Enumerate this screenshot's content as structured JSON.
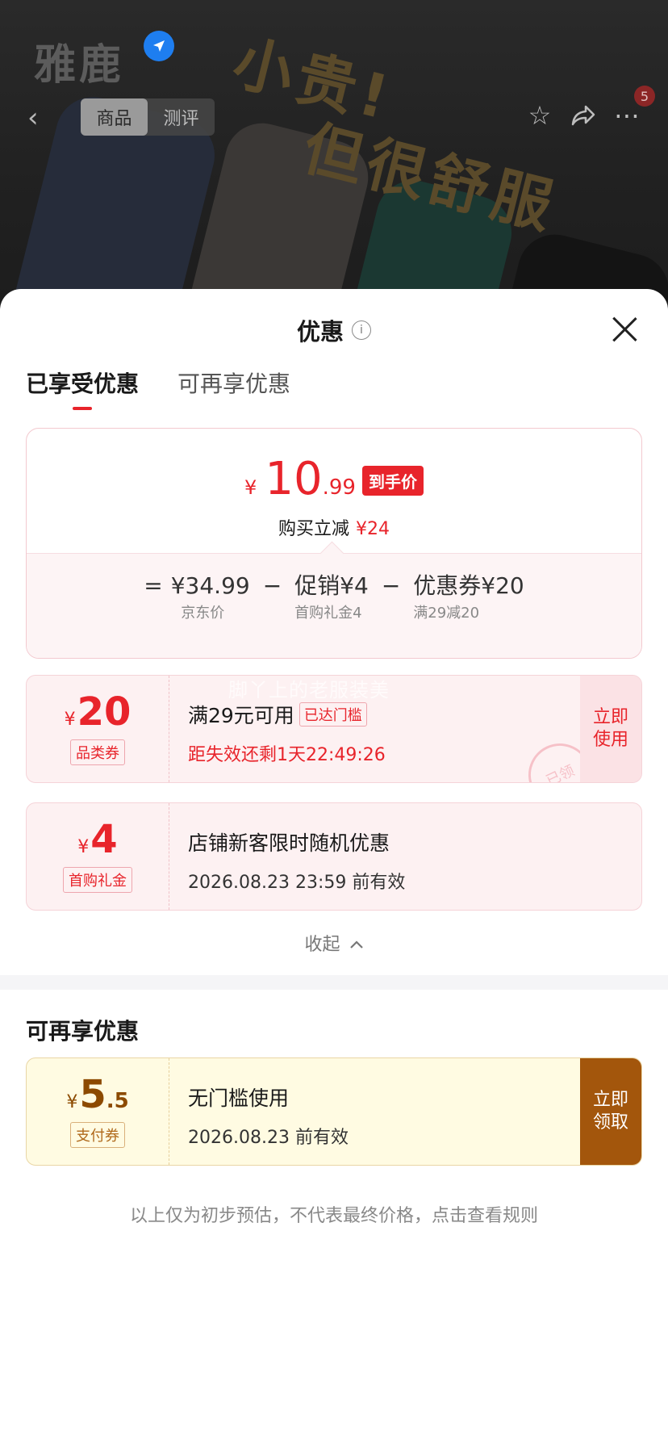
{
  "background_page": {
    "brand": "雅鹿",
    "slogan_line1": "小贵!",
    "slogan_line2": "但很舒服",
    "tabs": [
      "商品",
      "测评"
    ],
    "active_tab": "商品",
    "cart_badge": "5"
  },
  "sheet": {
    "title": "优惠",
    "tabs": [
      "已享受优惠",
      "可再享优惠"
    ],
    "price_summary": {
      "currency": "¥",
      "final_int": "10",
      "final_dec": ".99",
      "final_tag": "到手价",
      "reduce_label": "购买立减",
      "reduce_amount": "¥24",
      "formula": {
        "eq": "=",
        "minus": "−",
        "jd_price": "¥34.99",
        "jd_price_label": "京东价",
        "promo": "促销¥4",
        "promo_label": "首购礼金4",
        "coupon": "优惠券¥20",
        "coupon_label": "满29减20"
      }
    },
    "coupons_used": [
      {
        "currency": "¥",
        "amount": "20",
        "type": "品类券",
        "title": "满29元可用",
        "reach_tag": "已达门槛",
        "countdown": "距失效还剩1天22:49:26",
        "action": "立即使用",
        "stamp": "已领",
        "overlay_text": "脚丫上的老服装美"
      },
      {
        "currency": "¥",
        "amount": "4",
        "type": "首购礼金",
        "title": "店铺新客限时随机优惠",
        "validity": "2026.08.23 23:59 前有效"
      }
    ],
    "collapse_label": "收起",
    "more_section_title": "可再享优惠",
    "coupons_more": [
      {
        "currency": "¥",
        "amount_int": "5",
        "amount_dec": ".5",
        "type": "支付券",
        "title": "无门槛使用",
        "validity": "2026.08.23 前有效",
        "action": "立即领取"
      }
    ],
    "footer_note": "以上仅为初步预估，不代表最终价格，点击查看规则"
  },
  "colors": {
    "accent_red": "#e8242b",
    "gold_button": "#a3560c"
  }
}
